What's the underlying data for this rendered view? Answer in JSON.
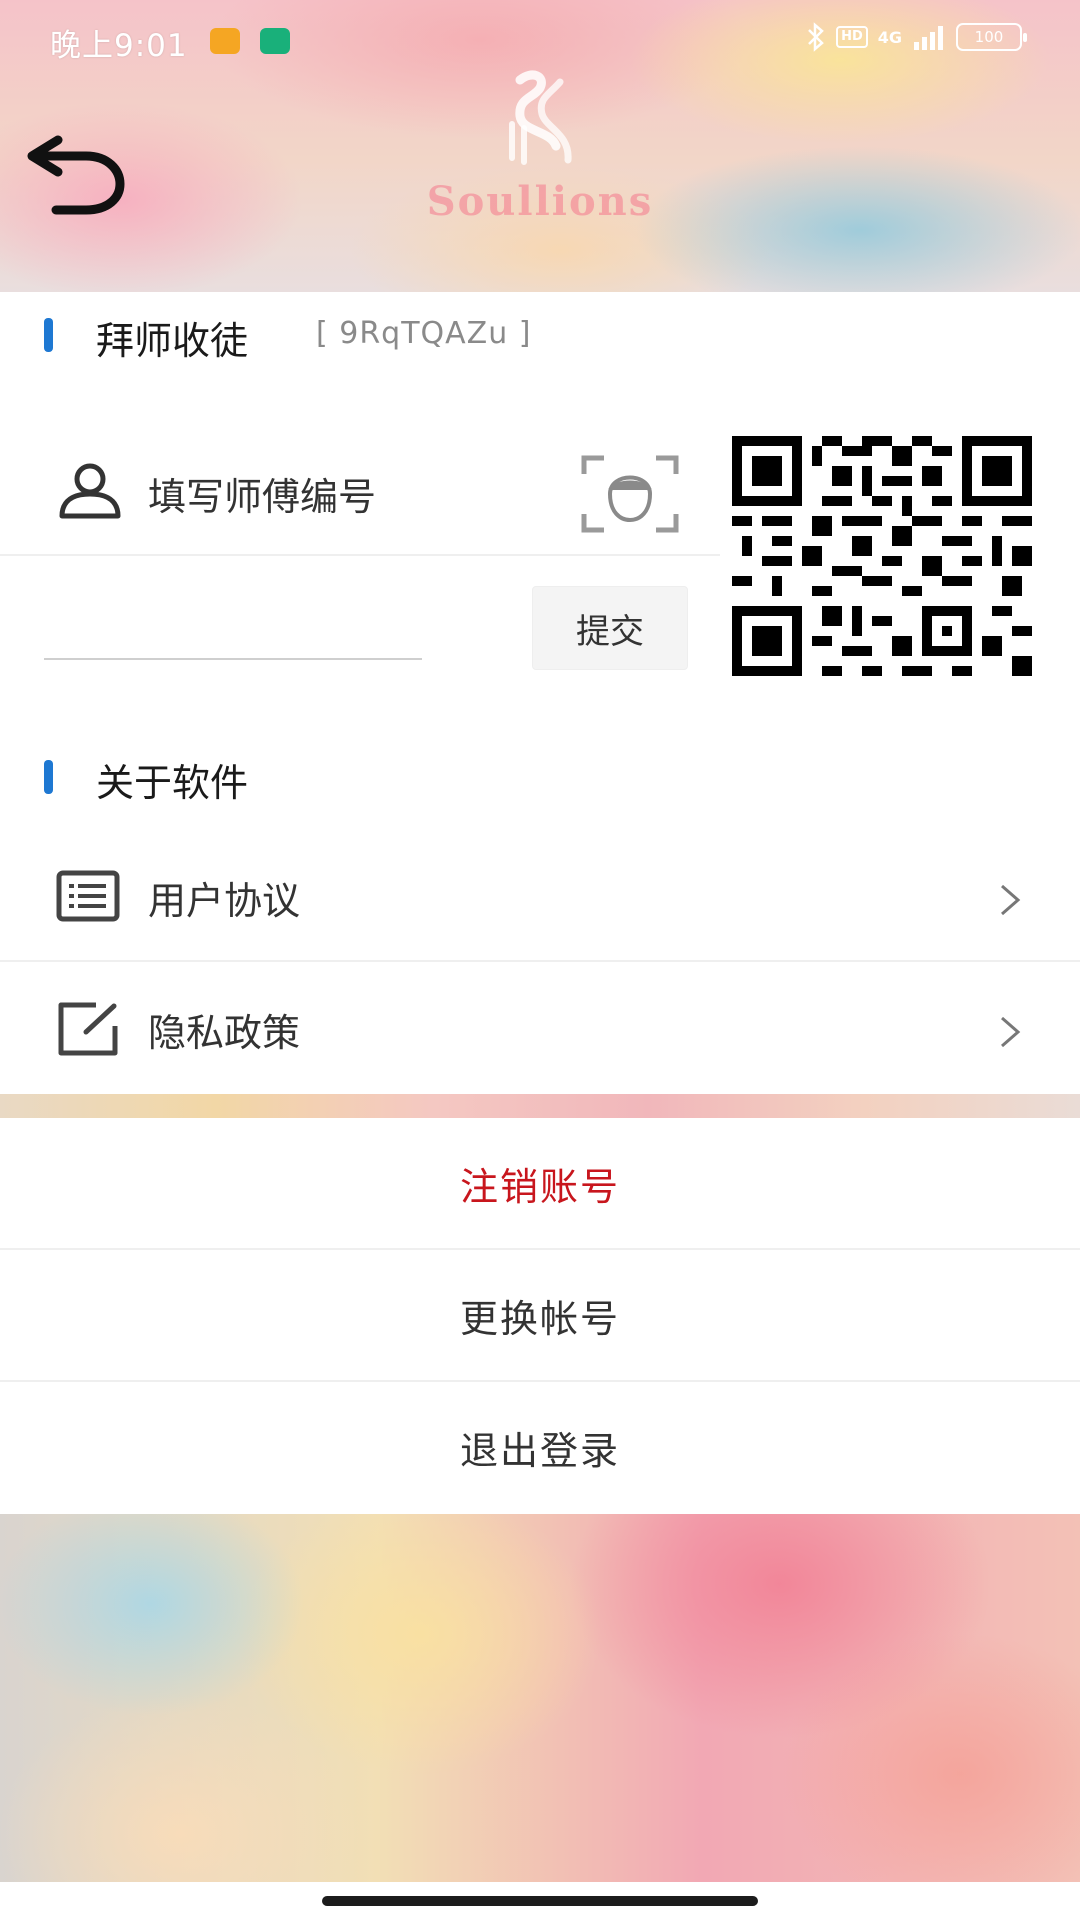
{
  "status_bar": {
    "time": "晚上9:01",
    "network": "4G",
    "hd": "HD",
    "battery": "100"
  },
  "header": {
    "logo_text": "Soullions"
  },
  "mentor_section": {
    "title": "拜师收徒",
    "invite_code": "[ 9RqTQAZu ]",
    "master_field_label": "填写师傅编号",
    "code_input_value": "",
    "submit_label": "提交"
  },
  "about_section": {
    "title": "关于软件",
    "items": [
      {
        "label": "用户协议",
        "icon": "document-list-icon"
      },
      {
        "label": "隐私政策",
        "icon": "edit-box-icon"
      }
    ]
  },
  "account_actions": {
    "delete_account": "注销账号",
    "switch_account": "更换帐号",
    "logout": "退出登录"
  },
  "colors": {
    "accent": "#1e78d2",
    "danger": "#c8161d"
  }
}
